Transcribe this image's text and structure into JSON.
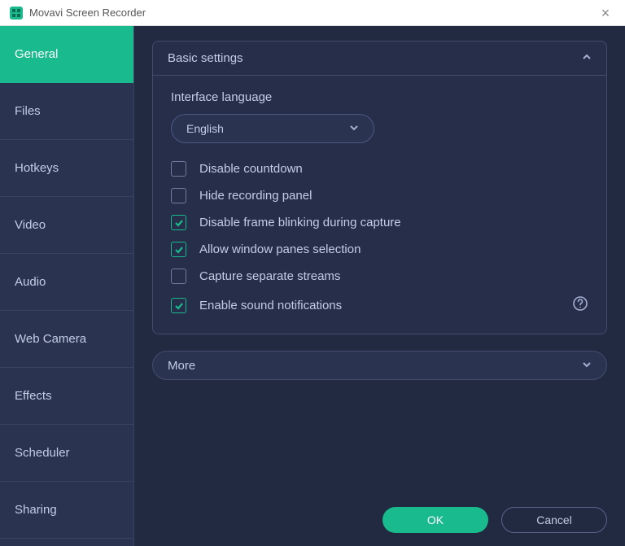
{
  "window": {
    "title": "Movavi Screen Recorder"
  },
  "sidebar": {
    "items": [
      {
        "label": "General",
        "active": true
      },
      {
        "label": "Files",
        "active": false
      },
      {
        "label": "Hotkeys",
        "active": false
      },
      {
        "label": "Video",
        "active": false
      },
      {
        "label": "Audio",
        "active": false
      },
      {
        "label": "Web Camera",
        "active": false
      },
      {
        "label": "Effects",
        "active": false
      },
      {
        "label": "Scheduler",
        "active": false
      },
      {
        "label": "Sharing",
        "active": false
      }
    ]
  },
  "basic_settings": {
    "header": "Basic settings",
    "language_label": "Interface language",
    "language_value": "English",
    "options": [
      {
        "label": "Disable countdown",
        "checked": false
      },
      {
        "label": "Hide recording panel",
        "checked": false
      },
      {
        "label": "Disable frame blinking during capture",
        "checked": true
      },
      {
        "label": "Allow window panes selection",
        "checked": true
      },
      {
        "label": "Capture separate streams",
        "checked": false
      },
      {
        "label": "Enable sound notifications",
        "checked": true,
        "help": true
      }
    ]
  },
  "more_section": {
    "label": "More"
  },
  "footer": {
    "ok": "OK",
    "cancel": "Cancel"
  }
}
